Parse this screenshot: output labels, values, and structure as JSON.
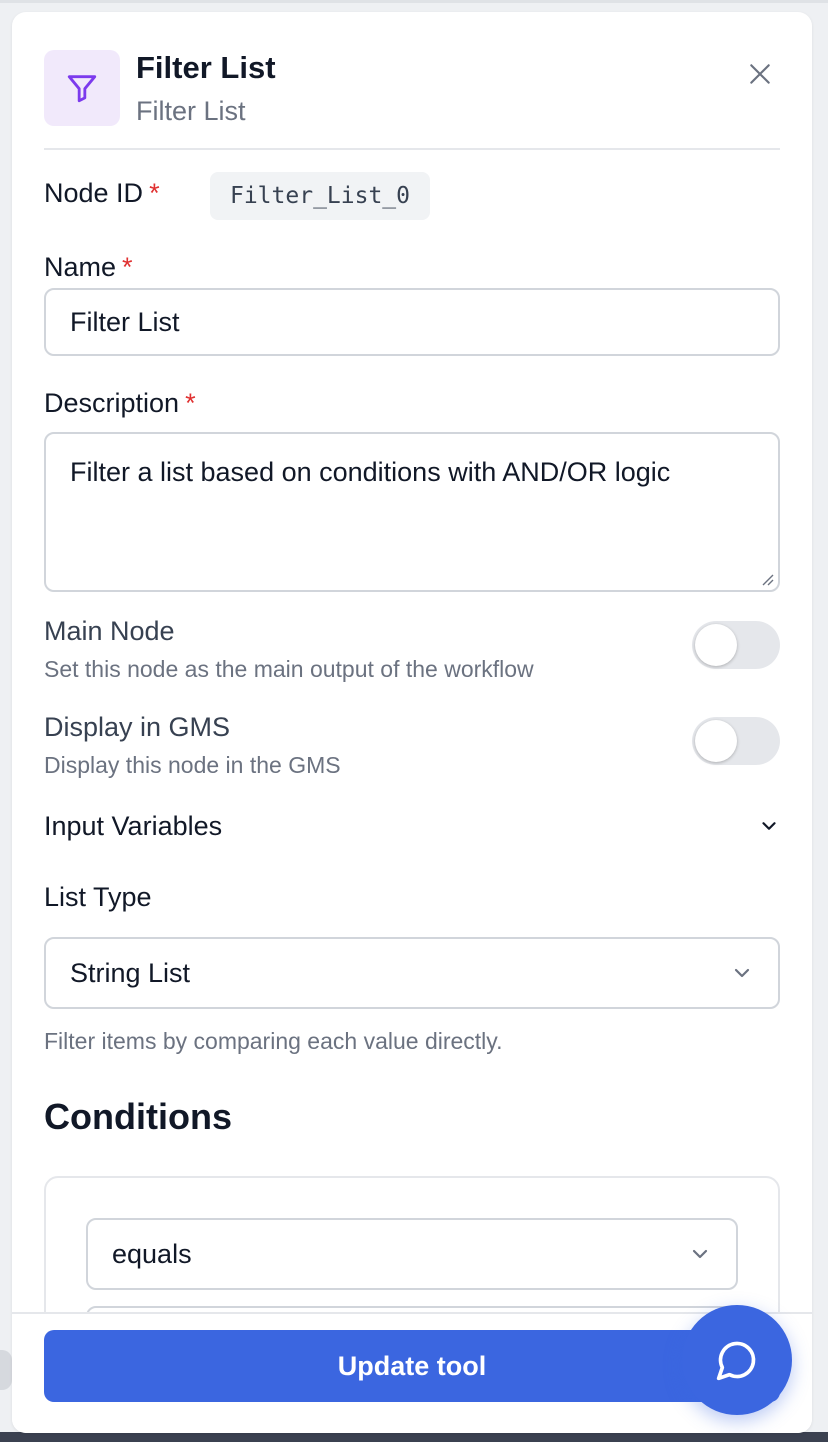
{
  "header": {
    "title": "Filter List",
    "subtitle": "Filter List",
    "icon": "filter-icon",
    "icon_color": "#7c3aed"
  },
  "fields": {
    "node_id": {
      "label": "Node ID",
      "required_mark": "*",
      "value": "Filter_List_0"
    },
    "name": {
      "label": "Name",
      "required_mark": "*",
      "value": "Filter List"
    },
    "description": {
      "label": "Description",
      "required_mark": "*",
      "value": "Filter a list based on conditions with AND/OR logic"
    }
  },
  "toggles": {
    "main_node": {
      "title": "Main Node",
      "description": "Set this node as the main output of the workflow",
      "on": false
    },
    "display_gms": {
      "title": "Display in GMS",
      "description": "Display this node in the GMS",
      "on": false
    }
  },
  "input_variables": {
    "label": "Input Variables"
  },
  "list_type": {
    "label": "List Type",
    "selected": "String List",
    "help": "Filter items by comparing each value directly."
  },
  "conditions": {
    "title": "Conditions",
    "operator_selected": "equals"
  },
  "footer": {
    "update_label": "Update tool"
  },
  "colors": {
    "accent": "#3b66e0",
    "required": "#e03131",
    "icon_bg": "#f1e9fb"
  }
}
